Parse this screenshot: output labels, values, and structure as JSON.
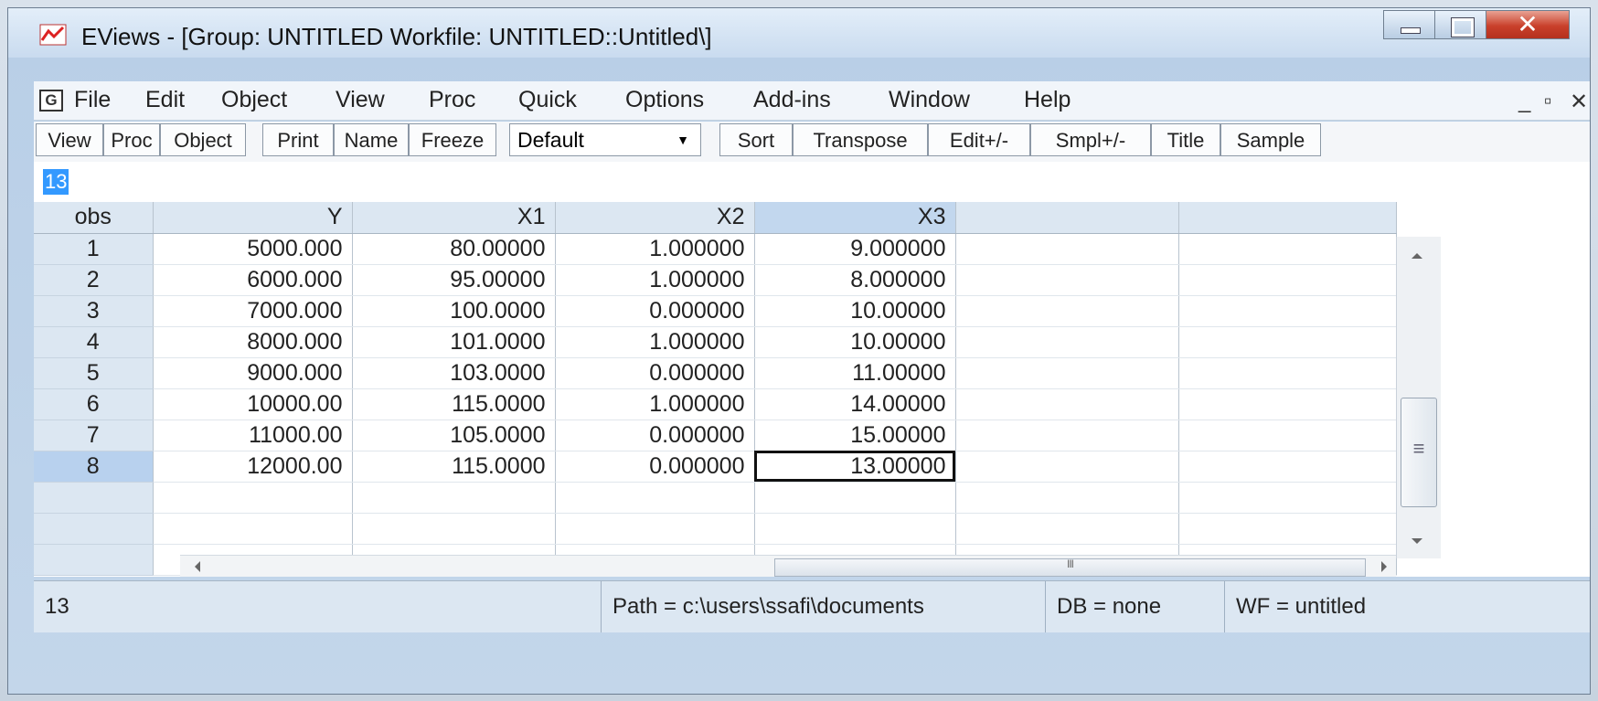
{
  "window": {
    "title": "EViews - [Group: UNTITLED   Workfile: UNTITLED::Untitled\\]"
  },
  "menubar": {
    "app_icon_letter": "G",
    "items": [
      "File",
      "Edit",
      "Object",
      "View",
      "Proc",
      "Quick",
      "Options",
      "Add-ins",
      "Window",
      "Help"
    ],
    "mdi_controls": [
      "_",
      "▫",
      "✕"
    ]
  },
  "toolbar": {
    "buttons": [
      "View",
      "Proc",
      "Object",
      "Print",
      "Name",
      "Freeze"
    ],
    "display_select": "Default",
    "buttons_right": [
      "Sort",
      "Transpose",
      "Edit+/-",
      "Smpl+/-",
      "Title",
      "Sample"
    ]
  },
  "edit_bar": {
    "value": "13"
  },
  "grid": {
    "headers": [
      "obs",
      "Y",
      "X1",
      "X2",
      "X3"
    ],
    "rows": [
      [
        "1",
        "5000.000",
        "80.00000",
        "1.000000",
        "9.000000"
      ],
      [
        "2",
        "6000.000",
        "95.00000",
        "1.000000",
        "8.000000"
      ],
      [
        "3",
        "7000.000",
        "100.0000",
        "0.000000",
        "10.00000"
      ],
      [
        "4",
        "8000.000",
        "101.0000",
        "1.000000",
        "10.00000"
      ],
      [
        "5",
        "9000.000",
        "103.0000",
        "0.000000",
        "11.00000"
      ],
      [
        "6",
        "10000.00",
        "115.0000",
        "1.000000",
        "14.00000"
      ],
      [
        "7",
        "11000.00",
        "105.0000",
        "0.000000",
        "15.00000"
      ],
      [
        "8",
        "12000.00",
        "115.0000",
        "0.000000",
        "13.00000"
      ]
    ],
    "selected_obs": "8",
    "selected_column": "X3",
    "active_cell_value": "13.00000"
  },
  "statusbar": {
    "value": "13",
    "path": "Path = c:\\users\\ssafi\\documents",
    "db": "DB = none",
    "wf": "WF = untitled"
  },
  "colors": {
    "title_bg": "#c9dbef",
    "header_bg": "#dce7f2",
    "selected_header_bg": "#c2d7ee",
    "edit_highlight": "#3399ff",
    "close_button": "#c9402b"
  }
}
